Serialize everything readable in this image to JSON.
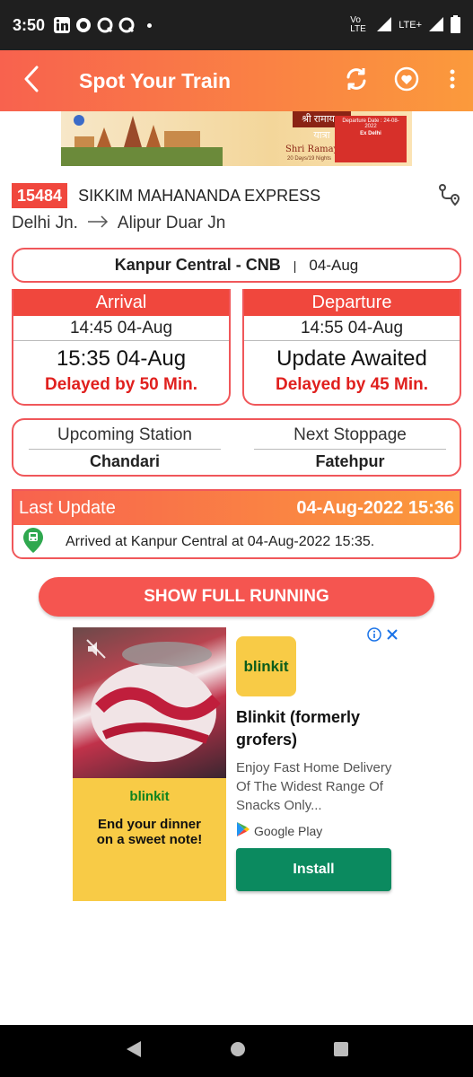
{
  "status_bar": {
    "time": "3:50",
    "network": "Vo LTE",
    "signal": "LTE+"
  },
  "app_bar": {
    "title": "Spot Your Train"
  },
  "banner": {
    "hindi_title": "श्री रामायण यात्रा",
    "english_title": "Shri Ramayana Yatra",
    "departure": "Departure Date : 24-08-2022",
    "origin": "Ex Delhi",
    "duration": "20 Days/19 Nights"
  },
  "train": {
    "number": "15484",
    "name": "SIKKIM MAHANANDA EXPRESS",
    "from": "Delhi Jn.",
    "to": "Alipur Duar Jn"
  },
  "station": {
    "name": "Kanpur Central - CNB",
    "separator": "|",
    "date": "04-Aug"
  },
  "arrival": {
    "label": "Arrival",
    "scheduled": "14:45 04-Aug",
    "actual": "15:35 04-Aug",
    "delay": "Delayed by 50 Min."
  },
  "departure": {
    "label": "Departure",
    "scheduled": "14:55 04-Aug",
    "actual": "Update Awaited",
    "delay": "Delayed by 45 Min."
  },
  "next": {
    "upcoming_label": "Upcoming Station",
    "upcoming_value": "Chandari",
    "stoppage_label": "Next Stoppage",
    "stoppage_value": "Fatehpur"
  },
  "last_update": {
    "label": "Last Update",
    "datetime": "04-Aug-2022 15:36",
    "message": "Arrived at Kanpur Central at 04-Aug-2022 15:35."
  },
  "full_running_button": "SHOW FULL RUNNING",
  "ad": {
    "brand": "blinkit",
    "tagline": "End your dinner on a sweet note!",
    "title": "Blinkit (formerly grofers)",
    "description": "Enjoy Fast Home Delivery Of The Widest Range Of Snacks Only...",
    "store": "Google Play",
    "install_label": "Install"
  },
  "colors": {
    "accent_red": "#f0473d",
    "gradient_orange": "#fb9a3c",
    "delay_red": "#e0201e",
    "install_green": "#0b8a5f"
  }
}
